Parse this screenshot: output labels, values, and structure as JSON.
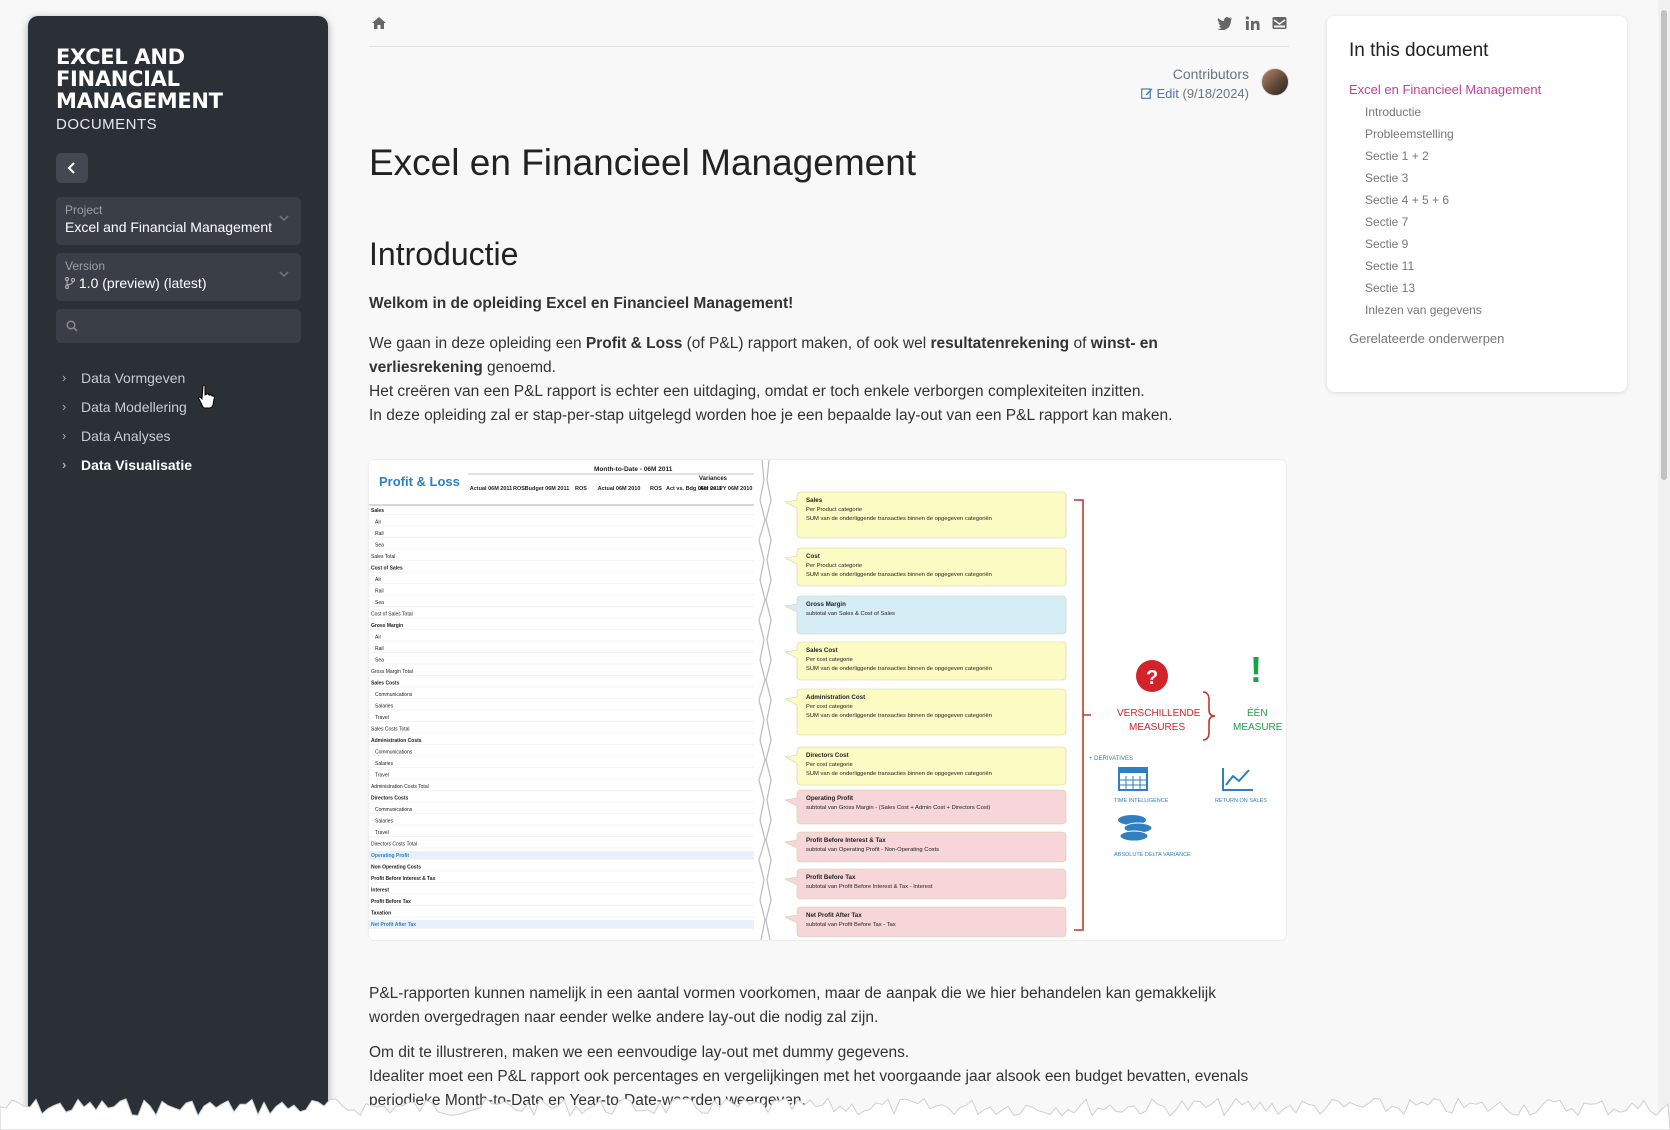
{
  "sidebar": {
    "brand_title": "EXCEL AND FINANCIAL MANAGEMENT",
    "brand_sub": "DOCUMENTS",
    "project_label": "Project",
    "project_value": "Excel and Financial Management",
    "version_label": "Version",
    "version_value": "1.0 (preview) (latest)",
    "nav": [
      {
        "label": "Data Vormgeven"
      },
      {
        "label": "Data Modellering"
      },
      {
        "label": "Data Analyses"
      },
      {
        "label": "Data Visualisatie"
      }
    ]
  },
  "header": {
    "contributors_label": "Contributors",
    "edit_label": "Edit",
    "edit_date": "(9/18/2024)"
  },
  "article": {
    "title": "Excel en Financieel Management",
    "section_title": "Introductie",
    "welcome": "Welkom in de opleiding Excel en Financieel Management!",
    "p1_a": "We gaan in deze opleiding een ",
    "p1_b": "Profit & Loss",
    "p1_c": " (of P&L) rapport maken, of ook wel ",
    "p1_d": "resultatenrekening",
    "p1_e": " of ",
    "p1_f": "winst- en verliesrekening",
    "p1_g": " genoemd.",
    "p2": "Het creëren van een P&L rapport is echter een uitdaging, omdat er toch enkele verborgen complexiteiten inzitten.",
    "p3": "In deze opleiding zal er stap-per-stap uitgelegd worden hoe je een bepaalde lay-out van een P&L rapport kan maken.",
    "p4": "P&L-rapporten kunnen namelijk in een aantal vormen voorkomen, maar de aanpak die we hier behandelen kan gemakkelijk worden overgedragen naar eender welke andere lay-out die nodig zal zijn.",
    "p5": "Om dit te illustreren, maken we een eenvoudige lay-out met dummy gegevens.",
    "p6": "Idealiter moet een P&L rapport ook percentages en vergelijkingen met het voorgaande jaar alsook een budget bevatten, evenals periodieke Month-to-Date en Year-to-Date-waarden weergeven."
  },
  "figure": {
    "pl_title": "Profit & Loss",
    "mtd_header": "Month-to-Date - 06M 2011",
    "variances": "Variances",
    "cols": [
      "Actual 06M 2011",
      "ROS",
      "Budget 06M 2011",
      "ROS",
      "Actual 06M 2010",
      "ROS",
      "Act vs. Bdg 06M 2011",
      "Act vs. PY 06M 2010"
    ],
    "row_labels": [
      "Sales",
      "Air",
      "Rail",
      "Sea",
      "Sales Total",
      "Cost of Sales",
      "Air",
      "Rail",
      "Sea",
      "Cost of Sales Total",
      "Gross Margin",
      "Air",
      "Rail",
      "Sea",
      "Gross Margin Total",
      "Sales Costs",
      "Communications",
      "Salaries",
      "Travel",
      "Sales Costs Total",
      "Administration Costs",
      "Communications",
      "Salaries",
      "Travel",
      "Administration Costs Total",
      "Directors Costs",
      "Communications",
      "Salaries",
      "Travel",
      "Directors Costs Total",
      "Operating Profit",
      "Non Operating Costs",
      "Profit Before Interest & Tax",
      "Interest",
      "Profit Before Tax",
      "Taxation",
      "Net Profit After Tax"
    ],
    "boxes": [
      {
        "title": "Sales",
        "l1": "Per Product categorie",
        "l2": "SUM van de onderliggende transacties binnen de opgegeven categoriën",
        "color": "#fdfbc4"
      },
      {
        "title": "Cost",
        "l1": "Per Product categorie",
        "l2": "SUM van de onderliggende transacties binnen de opgegeven categoriën",
        "color": "#fdfbc4"
      },
      {
        "title": "Gross Margin",
        "l1": "subtotal van Sales & Cost of Sales",
        "l2": "",
        "color": "#d6edf5"
      },
      {
        "title": "Sales Cost",
        "l1": "Per cost categorie",
        "l2": "SUM van de onderliggende transacties binnen de opgegeven categoriën",
        "color": "#fdfbc4"
      },
      {
        "title": "Administration Cost",
        "l1": "Per cost categorie",
        "l2": "SUM van de onderliggende transacties binnen de opgegeven categoriën",
        "color": "#fdfbc4"
      },
      {
        "title": "Directors Cost",
        "l1": "Per cost categorie",
        "l2": "SUM van de onderliggende transacties binnen de opgegeven categoriën",
        "color": "#fdfbc4"
      },
      {
        "title": "Operating Profit",
        "l1": "subtotal van Gross Margin - (Sales Cost + Admin Cost + Directors Cost)",
        "l2": "",
        "color": "#f6d6d8"
      },
      {
        "title": "Profit Before Interest & Tax",
        "l1": "subtotal van Operating Profit - Non-Operating Costs",
        "l2": "",
        "color": "#f6d6d8"
      },
      {
        "title": "Profit Before Tax",
        "l1": "subtotal van Profit Before Interest & Tax - Interest",
        "l2": "",
        "color": "#f6d6d8"
      },
      {
        "title": "Net Profit After Tax",
        "l1": "subtotal van Profit Before Tax - Tax",
        "l2": "",
        "color": "#f6d6d8"
      }
    ],
    "verschillende": "VERSCHILLENDE",
    "measures": "MEASURES",
    "een": "ÉÉN",
    "measure": "MEASURE",
    "derivatives": "+ DERIVATIVES",
    "time_intel": "TIME INTELLIGENCE",
    "return_sales": "RETURN ON SALES",
    "abs_delta": "ABSOLUTE DELTA VARIANCE"
  },
  "toc": {
    "heading": "In this document",
    "top": "Excel en Financieel Management",
    "items": [
      "Introductie",
      "Probleemstelling",
      "Sectie 1 + 2",
      "Sectie 3",
      "Sectie 4 + 5 + 6",
      "Sectie 7",
      "Sectie 9",
      "Sectie 11",
      "Sectie 13",
      "Inlezen van gegevens"
    ],
    "related": "Gerelateerde onderwerpen"
  },
  "icons": [
    "home-icon",
    "twitter-icon",
    "linkedin-icon",
    "mail-icon",
    "back-chevron-icon",
    "search-icon",
    "branch-icon",
    "edit-icon"
  ],
  "colors": {
    "sidebar_bg": "#2b2f36",
    "toc_active": "#c2419c",
    "link": "#4a78b8",
    "red": "#d3232a",
    "green": "#19a34a",
    "blue": "#2f7fc1"
  }
}
